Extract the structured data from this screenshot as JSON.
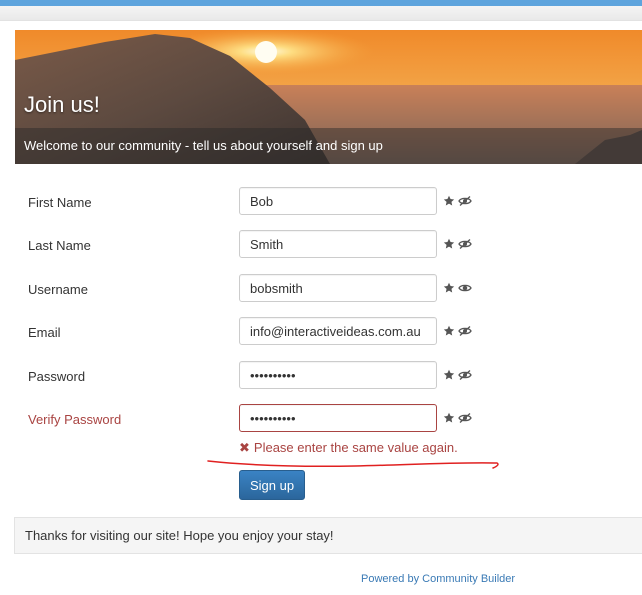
{
  "header": {
    "title": "Join us!",
    "subtitle": "Welcome to our community - tell us about yourself and sign up"
  },
  "form": {
    "fields": [
      {
        "label": "First Name",
        "value": "Bob",
        "type": "text",
        "eye_icon": "eye-slash-icon"
      },
      {
        "label": "Last Name",
        "value": "Smith",
        "type": "text",
        "eye_icon": "eye-slash-icon"
      },
      {
        "label": "Username",
        "value": "bobsmith",
        "type": "text",
        "eye_icon": "eye-icon"
      },
      {
        "label": "Email",
        "value": "info@interactiveideas.com.au",
        "type": "text",
        "eye_icon": "eye-slash-icon"
      },
      {
        "label": "Password",
        "value": "••••••••••",
        "type": "password",
        "eye_icon": "eye-slash-icon"
      },
      {
        "label": "Verify Password",
        "value": "••••••••••",
        "type": "password",
        "eye_icon": "eye-slash-icon",
        "error": true
      }
    ],
    "required_icon": "star-icon",
    "error_icon": "times-icon",
    "error_message": "Please enter the same value again.",
    "submit_label": "Sign up"
  },
  "footer": {
    "message": "Thanks for visiting our site! Hope you enjoy your stay!",
    "powered_by": "Powered by Community Builder"
  },
  "colors": {
    "accent": "#2b669c",
    "error": "#a94442",
    "annotation": "#e02020",
    "link": "#3a7ab5"
  }
}
